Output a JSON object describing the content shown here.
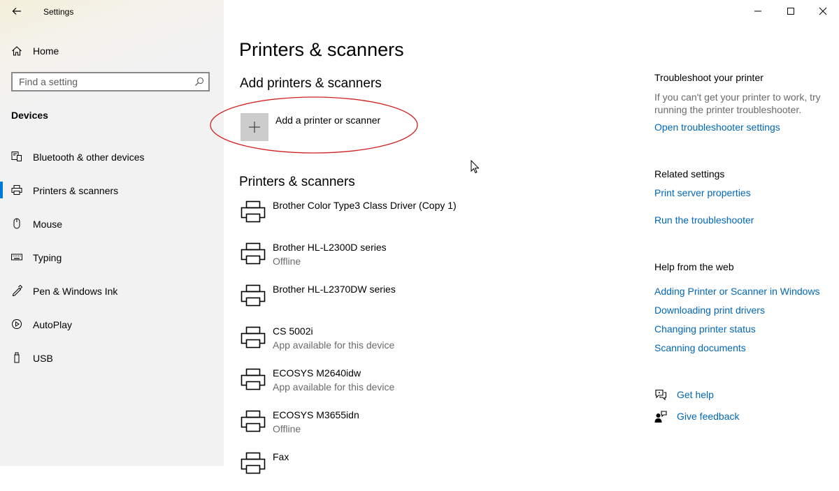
{
  "window": {
    "app_title": "Settings"
  },
  "sidebar": {
    "home_label": "Home",
    "search_placeholder": "Find a setting",
    "section": "Devices",
    "items": [
      {
        "label": "Bluetooth & other devices",
        "icon": "bluetooth-devices-icon",
        "active": false
      },
      {
        "label": "Printers & scanners",
        "icon": "printer-icon",
        "active": true
      },
      {
        "label": "Mouse",
        "icon": "mouse-icon",
        "active": false
      },
      {
        "label": "Typing",
        "icon": "keyboard-icon",
        "active": false
      },
      {
        "label": "Pen & Windows Ink",
        "icon": "pen-icon",
        "active": false
      },
      {
        "label": "AutoPlay",
        "icon": "autoplay-icon",
        "active": false
      },
      {
        "label": "USB",
        "icon": "usb-icon",
        "active": false
      }
    ]
  },
  "main": {
    "title": "Printers & scanners",
    "add_section_title": "Add printers & scanners",
    "add_button_label": "Add a printer or scanner",
    "list_title": "Printers & scanners",
    "printers": [
      {
        "name": "Brother Color Type3 Class Driver (Copy 1)",
        "status": ""
      },
      {
        "name": "Brother HL-L2300D series",
        "status": "Offline"
      },
      {
        "name": "Brother HL-L2370DW series",
        "status": ""
      },
      {
        "name": "CS 5002i",
        "status": "App available for this device"
      },
      {
        "name": "ECOSYS M2640idw",
        "status": "App available for this device"
      },
      {
        "name": "ECOSYS M3655idn",
        "status": "Offline"
      },
      {
        "name": "Fax",
        "status": ""
      }
    ]
  },
  "right": {
    "troubleshoot_title": "Troubleshoot your printer",
    "troubleshoot_text": "If you can't get your printer to work, try running the printer troubleshooter.",
    "troubleshoot_link": "Open troubleshooter settings",
    "related_title": "Related settings",
    "related_links": [
      "Print server properties",
      "Run the troubleshooter"
    ],
    "web_title": "Help from the web",
    "web_links": [
      "Adding Printer or Scanner in Windows",
      "Downloading print drivers",
      "Changing printer status",
      "Scanning documents"
    ],
    "get_help": "Get help",
    "give_feedback": "Give feedback"
  },
  "colors": {
    "accent": "#0078d7",
    "link": "#0067b8",
    "annotation": "#d42020"
  }
}
